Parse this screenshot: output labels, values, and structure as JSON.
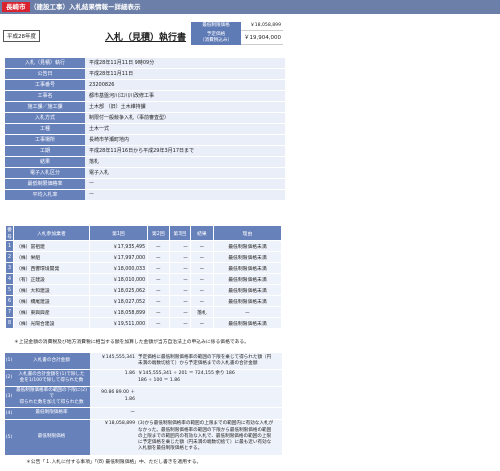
{
  "header": {
    "city": "長崎市",
    "title": "（建設工事）入札結果情報ー詳細表示"
  },
  "year_badge": "平成28年度",
  "doc_title": "入札（見積）執行書",
  "price": {
    "max_label": "最低制限価格",
    "max_value": "￥18,058,899",
    "est_label": "予定価格\n（消費税込み）",
    "est_value": "￥19,904,000"
  },
  "info": [
    {
      "k": "入札（見積）執行",
      "v": "平成28年11月11日 9時09分"
    },
    {
      "k": "公告日",
      "v": "平成28年11月11日"
    },
    {
      "k": "工事番号",
      "v": "23200826"
    },
    {
      "k": "工事名",
      "v": "都市基盤河川江川川改修工事"
    },
    {
      "k": "施工課／施工課",
      "v": "土木部 （旧）土木維持課"
    },
    {
      "k": "入札方式",
      "v": "制限付一般競争入札（事前審査型）"
    },
    {
      "k": "工種",
      "v": "土木一式"
    },
    {
      "k": "工事場所",
      "v": "長崎市芋瀬町地内"
    },
    {
      "k": "工期",
      "v": "平成28年11月16日から平成29年3月17日まで"
    },
    {
      "k": "結果",
      "v": "落札"
    },
    {
      "k": "電子入札区分",
      "v": "電子入札"
    },
    {
      "k": "最低制限価格率",
      "v": "ー"
    },
    {
      "k": "平均入札率",
      "v": "ー"
    }
  ],
  "bids_head": {
    "no": "番号",
    "name": "入札参加業者",
    "r1": "第1回",
    "r2": "第2回",
    "r3": "第3回",
    "result": "結果",
    "note": "理由"
  },
  "bids": [
    {
      "no": "1",
      "name": "（株）冨祖建",
      "r1": "￥17,935,495",
      "r2": "ー",
      "r3": "ー",
      "result": "ー",
      "note": "最低制限価格未満"
    },
    {
      "no": "2",
      "name": "（株）栄組",
      "r1": "￥17,997,000",
      "r2": "ー",
      "r3": "ー",
      "result": "ー",
      "note": "最低制限価格未満"
    },
    {
      "no": "3",
      "name": "（株）西響環境開発",
      "r1": "￥18,000,033",
      "r2": "ー",
      "r3": "ー",
      "result": "ー",
      "note": "最低制限価格未満"
    },
    {
      "no": "4",
      "name": "（有）正建設",
      "r1": "￥18,010,000",
      "r2": "ー",
      "r3": "ー",
      "result": "ー",
      "note": "最低制限価格未満"
    },
    {
      "no": "5",
      "name": "（株）大和建設",
      "r1": "￥18,025,062",
      "r2": "ー",
      "r3": "ー",
      "result": "ー",
      "note": "最低制限価格未満"
    },
    {
      "no": "6",
      "name": "（株）橋尾建設",
      "r1": "￥18,027,052",
      "r2": "ー",
      "r3": "ー",
      "result": "ー",
      "note": "最低制限価格未満"
    },
    {
      "no": "7",
      "name": "（株）東興興産",
      "r1": "￥18,058,899",
      "r2": "ー",
      "r3": "ー",
      "result": "落札",
      "note": "ー"
    },
    {
      "no": "8",
      "name": "（株）光陽合建設",
      "r1": "￥19,511,000",
      "r2": "ー",
      "r3": "ー",
      "result": "ー",
      "note": "最低制限価格未満"
    }
  ],
  "note1": "＊上記金額の消費税及び地方消費税に相当する額を加算した金額が当方自治法上の申込みに係る価格である。",
  "calc": [
    {
      "no": "(1)",
      "k": "入札書の合計金額",
      "amt": "￥145,555,341",
      "desc": "予定価格に最低制限価格率の範囲の下限を乗じて得られた額（円未満の端数切捨て）から予定価格までの入札書の合計金額"
    },
    {
      "no": "(2)",
      "k": "入札書の合計金額を(1)で除した\n金を1/100で除して得られた数",
      "amt": "1.86",
      "desc": "￥145,555,341 ÷ 201 ＝ 724,155 余り 186\n186 ÷ 100 ＝ 1.86"
    },
    {
      "no": "(3)",
      "k": "最低制限価格率の範囲の下限に(2)で\n得られた数を加えて得られた数",
      "amt": "90.86 89.00 ＋ 1.86",
      "desc": ""
    },
    {
      "no": "(4)",
      "k": "最低制限価格率",
      "amt": "ー",
      "desc": ""
    },
    {
      "no": "(5)",
      "k": "最低制限価格",
      "amt": "￥18,058,899",
      "desc": "(3)から最低制限価格率の範囲の上限までの範囲内に有効な入札がなかった。最低制限価格率の範囲の下限から最低制限価格の範囲の上限までの範囲内の有効な入札で、最低制限価格の範囲の上限に予定価格を乗じた額（円未満の端数切捨て）に最も近い有効な入札額を最低制限価格とする。"
    }
  ],
  "note2": "＊公告「１.入札に付する事項」「(8) 最低制限価格」中、ただし書きを適用する。"
}
